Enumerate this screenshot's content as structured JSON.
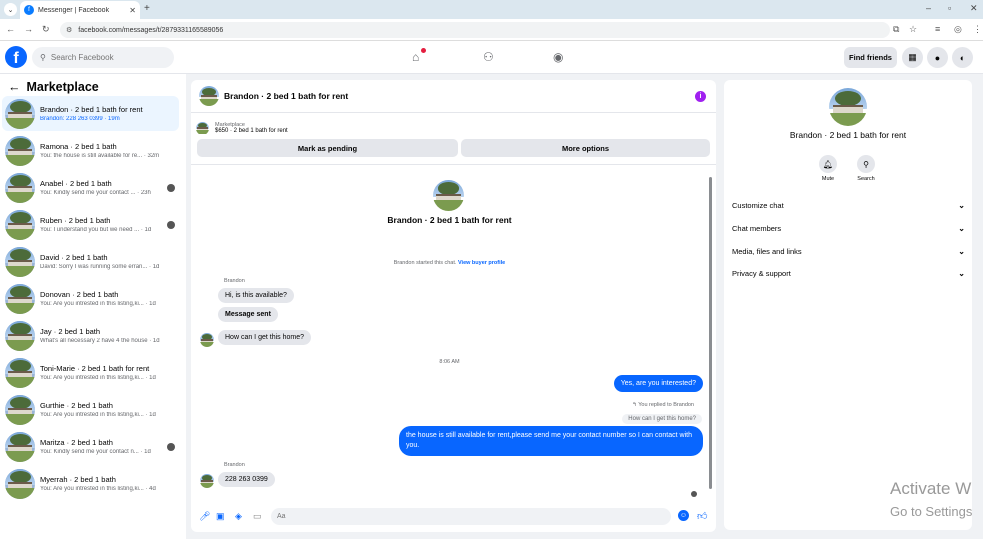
{
  "browser": {
    "tab_title": "Messenger | Facebook",
    "url": "facebook.com/messages/t/2879331165589056"
  },
  "fb": {
    "search_placeholder": "Search Facebook",
    "find_friends": "Find friends"
  },
  "marketplace": {
    "title": "Marketplace",
    "conversations": [
      {
        "name": "Brandon · 2 bed 1 bath for rent",
        "preview": "Brandon: 228 263 0399 · 19m",
        "active": true
      },
      {
        "name": "Ramona · 2 bed 1 bath",
        "preview": "You: the house is still available for re... · 32m"
      },
      {
        "name": "Anabel · 2 bed 1 bath",
        "preview": "You: Kindly send me your contact ... · 23h"
      },
      {
        "name": "Ruben · 2 bed 1 bath",
        "preview": "You: I understand you but we need ... · 1d"
      },
      {
        "name": "David · 2 bed 1 bath",
        "preview": "David: Sorry I was running some erran... · 1d"
      },
      {
        "name": "Donovan · 2 bed 1 bath",
        "preview": "You: Are you intrested in this listing,ki... · 1d"
      },
      {
        "name": "Jay · 2 bed 1 bath",
        "preview": "What's all necessary 2 have 4 the house · 1d"
      },
      {
        "name": "Toni-Marie · 2 bed 1 bath for rent",
        "preview": "You: Are you intrested in this listing,ki... · 1d"
      },
      {
        "name": "Gurthie · 2 bed 1 bath",
        "preview": "You: Are you intrested in this listing,ki... · 1d"
      },
      {
        "name": "Maritza · 2 bed 1 bath",
        "preview": "You: Kindly send me your contact n... · 1d"
      },
      {
        "name": "Myerrah · 2 bed 1 bath",
        "preview": "You: Are you intrested in this listing,ki... · 4d"
      }
    ]
  },
  "chat": {
    "title": "Brandon · 2 bed 1 bath for rent",
    "listing_source": "Marketplace",
    "listing_detail": "$650 · 2 bed 1 bath for rent",
    "mark_pending": "Mark as pending",
    "more_options": "More options",
    "header_name": "Brandon · 2 bed 1 bath for rent",
    "started_text": "Brandon started this chat.",
    "view_profile": "View buyer profile",
    "sender1": "Brandon",
    "in1": "Hi, is this available?",
    "in2": "Message sent",
    "in3": "How can I get this home?",
    "timestamp": "8:06 AM",
    "out1": "Yes, are you interested?",
    "replied_to": "You replied to Brandon",
    "quoted": "How can I get this home?",
    "out2": "the house is still available for rent,please send me your contact number so I can contact with you.",
    "sender2": "Brandon",
    "in4": "228 263 0399",
    "composer_placeholder": "Aa"
  },
  "info_panel": {
    "name": "Brandon · 2 bed 1 bath for rent",
    "mute": "Mute",
    "search": "Search",
    "sections": [
      "Customize chat",
      "Chat members",
      "Media, files and links",
      "Privacy & support"
    ]
  },
  "watermark": {
    "line1": "Activate W",
    "line2": "Go to Settings"
  }
}
